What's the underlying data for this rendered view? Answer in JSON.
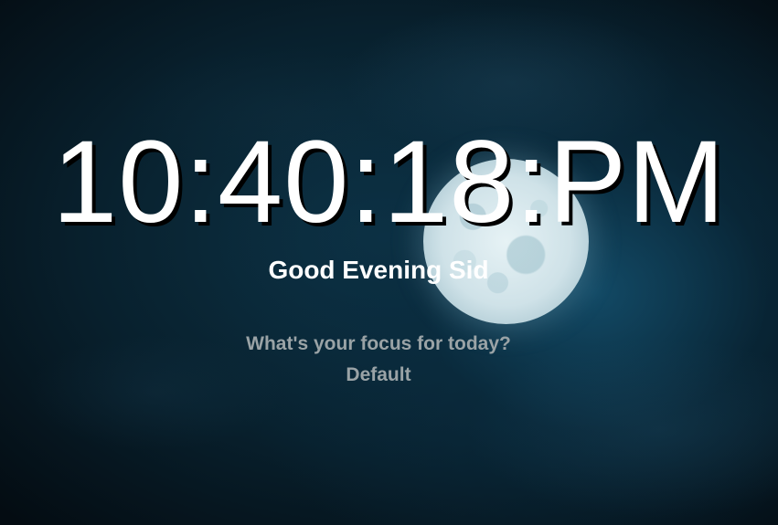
{
  "clock": {
    "time": "10:40:18:PM"
  },
  "greeting": {
    "text": "Good Evening Sid"
  },
  "focus": {
    "prompt": "What's your focus for today?",
    "value": "Default"
  },
  "background": {
    "image": "full-moon-night-sky",
    "colors": {
      "sky_dark": "#040c12",
      "sky_mid": "#0d3346",
      "moon": "#e6f2f5"
    }
  },
  "text_colors": {
    "primary": "#ffffff",
    "muted": "#9aa3a6"
  }
}
